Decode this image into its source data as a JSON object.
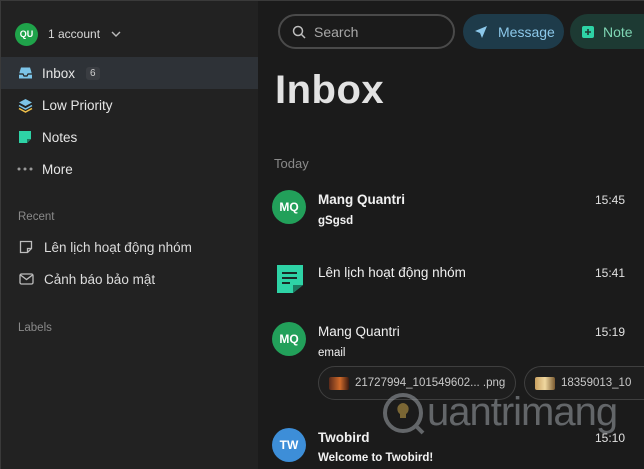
{
  "account": {
    "initials": "QU",
    "label": "1 account"
  },
  "nav": [
    {
      "label": "Inbox",
      "badge": "6",
      "icon": "inbox-icon"
    },
    {
      "label": "Low Priority",
      "icon": "layers-icon"
    },
    {
      "label": "Notes",
      "icon": "note-icon"
    },
    {
      "label": "More",
      "icon": "more-icon"
    }
  ],
  "recent": {
    "title": "Recent",
    "items": [
      {
        "label": "Lên lịch hoạt động nhóm",
        "icon": "note-outline-icon"
      },
      {
        "label": "Cảnh báo bảo mật",
        "icon": "mail-icon"
      }
    ]
  },
  "labels": {
    "title": "Labels"
  },
  "toolbar": {
    "search_placeholder": "Search",
    "message_label": "Message",
    "note_label": "Note"
  },
  "main": {
    "title": "Inbox",
    "group": "Today",
    "items": [
      {
        "initials": "MQ",
        "sender": "Mang Quantri",
        "subject": "gSgsd",
        "time": "15:45"
      },
      {
        "sender": "Lên lịch hoạt động nhóm",
        "time": "15:41"
      },
      {
        "initials": "MQ",
        "sender": "Mang Quantri",
        "subject": "email",
        "time": "15:19",
        "attachments": [
          "21727994_101549602... .png",
          "18359013_10"
        ]
      },
      {
        "initials": "TW",
        "sender": "Twobird",
        "subject": "Welcome to Twobird!",
        "time": "15:10"
      }
    ]
  },
  "watermark": "uantrimang",
  "colors": {
    "mq_avatar": "#22a05a",
    "tw_avatar": "#3d8ed8",
    "note_accent": "#2ed3a6",
    "message_accent": "#8cc8ea",
    "account_green": "#1fa34a"
  }
}
